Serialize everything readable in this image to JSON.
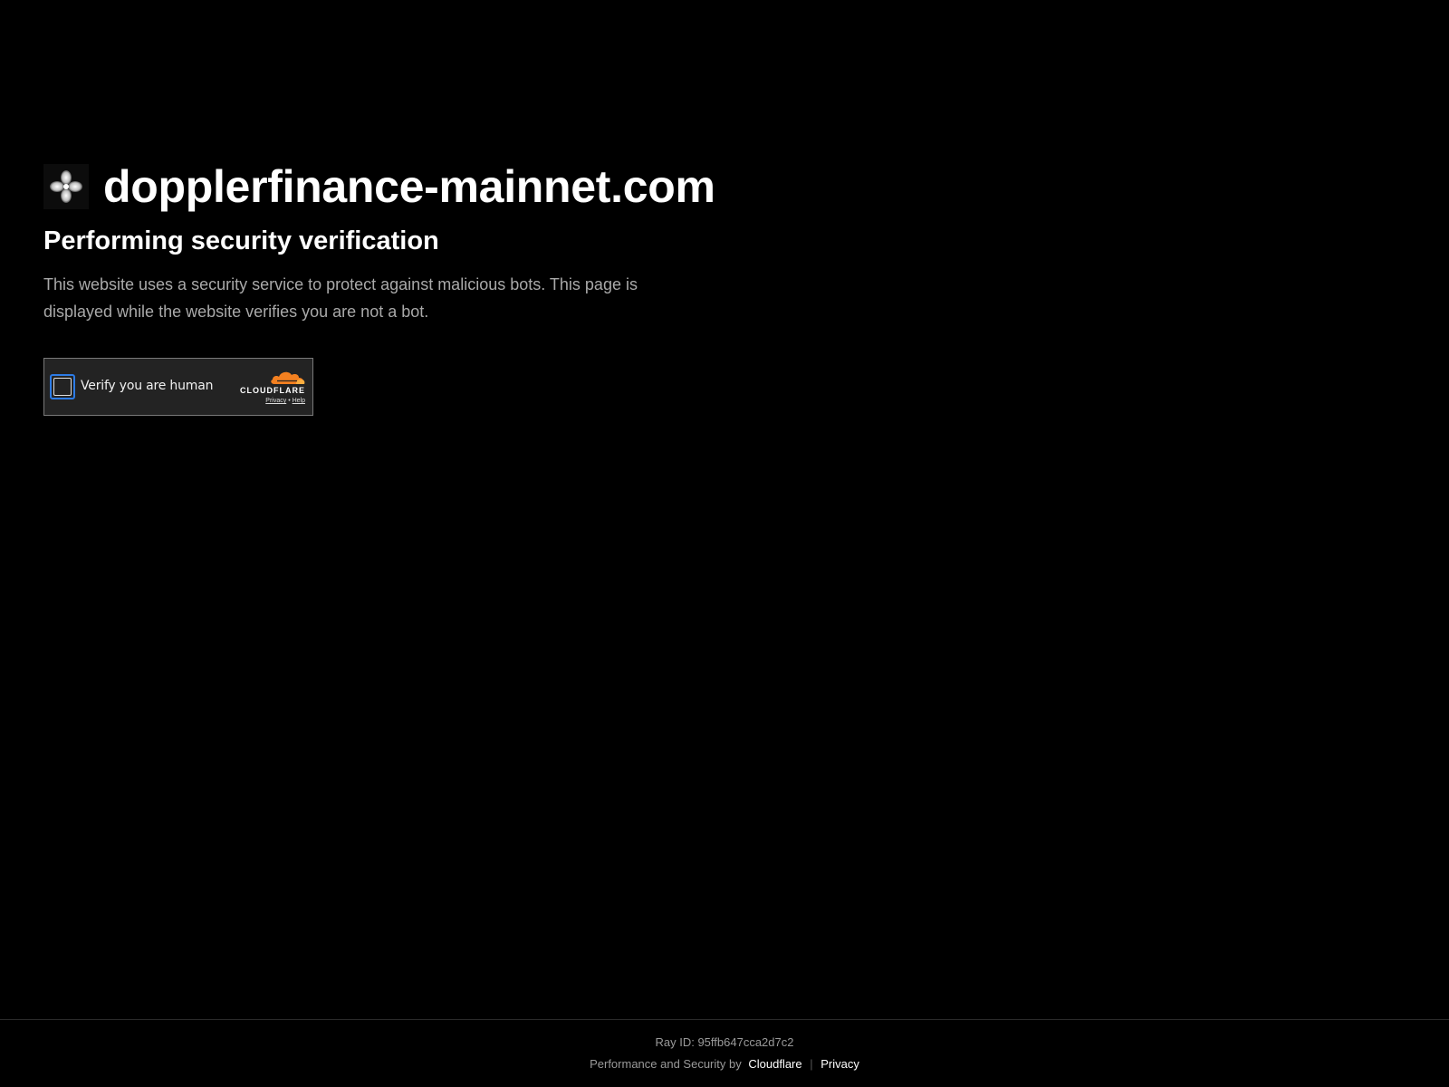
{
  "site": {
    "domain": "dopplerfinance-mainnet.com",
    "favicon_icon": "clover-logo-icon"
  },
  "main": {
    "heading": "Performing security verification",
    "description": "This website uses a security service to protect against malicious bots. This page is displayed while the website verifies you are not a bot."
  },
  "widget": {
    "checkbox_label": "Verify you are human",
    "checked": false,
    "brand_name": "CLOUDFLARE",
    "brand_icon": "cloudflare-cloud-icon",
    "privacy_link": "Privacy",
    "links_separator": "•",
    "help_link": "Help",
    "accent_color": "#f38020",
    "checkbox_border_color": "#2c7be5"
  },
  "footer": {
    "ray_id_text": "Ray ID: 95ffb647cca2d7c2",
    "performance_prefix": "Performance and Security by",
    "cloudflare_link": "Cloudflare",
    "separator": "|",
    "privacy_link": "Privacy"
  }
}
